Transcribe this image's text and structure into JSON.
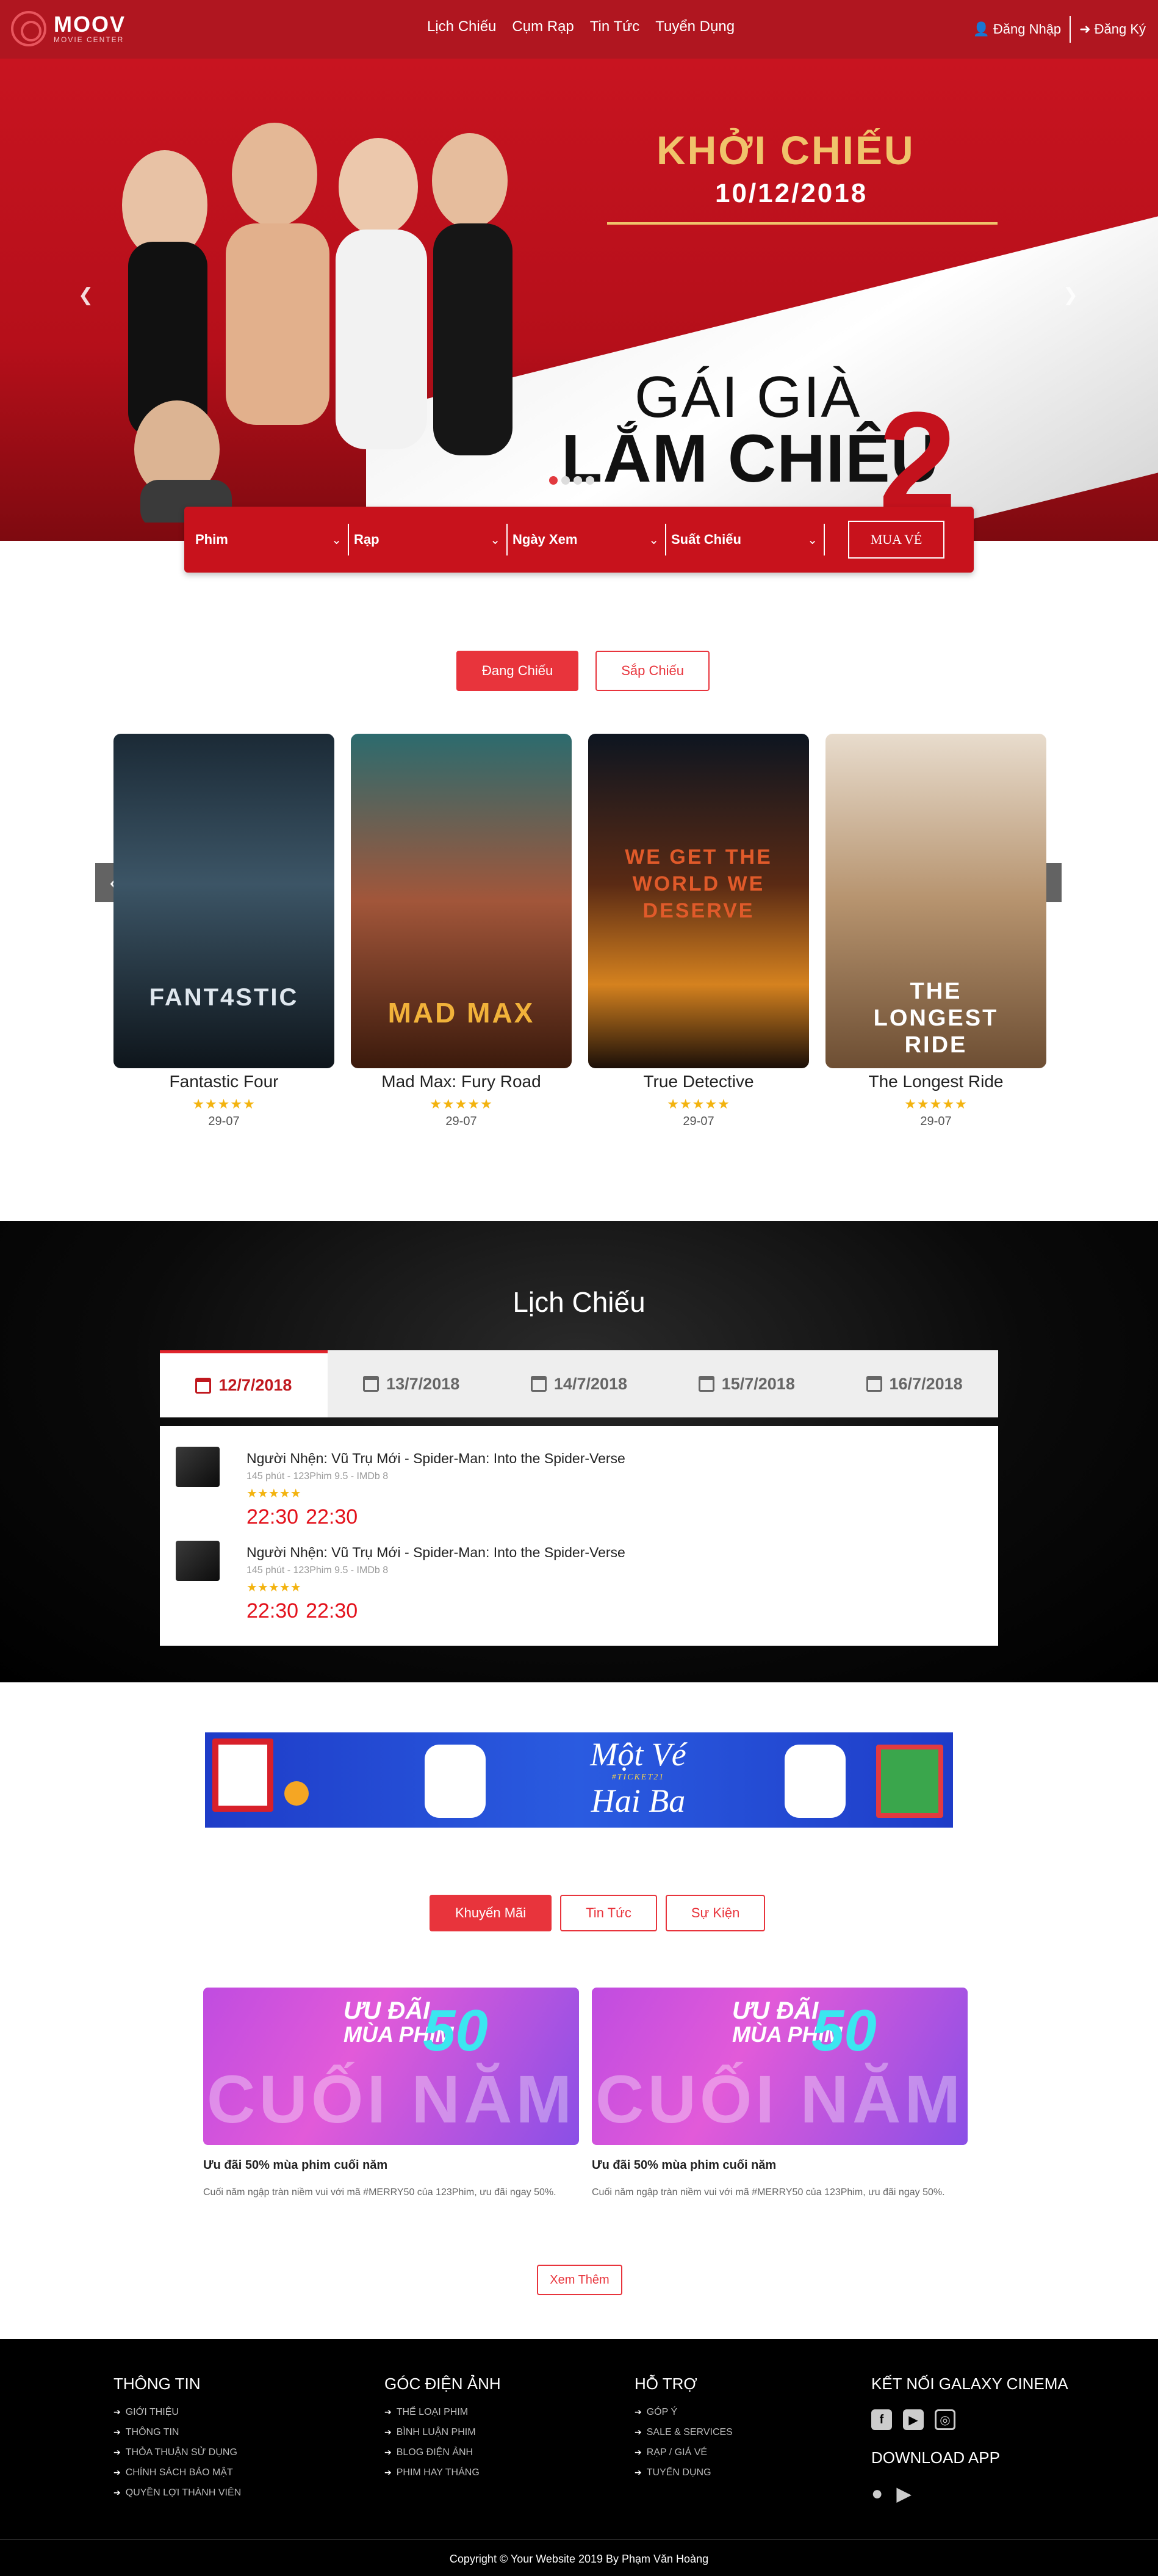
{
  "header": {
    "logo_title": "MOOV",
    "logo_sub": "MOVIE CENTER",
    "nav": [
      "Lịch Chiếu",
      "Cụm Rạp",
      "Tin Tức",
      "Tuyển Dụng"
    ],
    "login": "Đăng Nhập",
    "register": "Đăng Ký"
  },
  "hero": {
    "kicker": "KHỞI CHIẾU",
    "date": "10/12/2018",
    "title_line1": "GÁI GIÀ",
    "title_line2": "LẮM CHIÊU",
    "title_number": "2",
    "slide_count": 4,
    "active_slide": 1
  },
  "booking": {
    "fields": [
      "Phim",
      "Rạp",
      "Ngày Xem",
      "Suất Chiếu"
    ],
    "buy_label": "MUA VÉ"
  },
  "movie_tabs": {
    "now_showing": "Đang Chiếu",
    "coming_soon": "Sắp Chiếu"
  },
  "movies": [
    {
      "title": "Fantastic Four",
      "date": "29-07",
      "rating": 5,
      "poster_text": "FANT4STIC"
    },
    {
      "title": "Mad Max: Fury Road",
      "date": "29-07",
      "rating": 5,
      "poster_text": "MAD MAX"
    },
    {
      "title": "True Detective",
      "date": "29-07",
      "rating": 5,
      "poster_text": "WE GET THE WORLD WE DESERVE"
    },
    {
      "title": "The Longest Ride",
      "date": "29-07",
      "rating": 5,
      "poster_text": "THE LONGEST RIDE"
    }
  ],
  "schedule": {
    "title": "Lịch Chiếu",
    "days": [
      "12/7/2018",
      "13/7/2018",
      "14/7/2018",
      "15/7/2018",
      "16/7/2018"
    ],
    "active_day": 0,
    "shows": [
      {
        "name": "Người Nhện: Vũ Trụ Mới - Spider-Man: Into the Spider-Verse",
        "meta": "145 phút - 123Phim 9.5 - IMDb 8",
        "rating": 5,
        "times": [
          "22:30",
          "22:30"
        ]
      },
      {
        "name": "Người Nhện: Vũ Trụ Mới - Spider-Man: Into the Spider-Verse",
        "meta": "145 phút - 123Phim 9.5 - IMDb 8",
        "rating": 5,
        "times": [
          "22:30",
          "22:30"
        ]
      }
    ]
  },
  "banner": {
    "line1": "Một Vé",
    "tag": "#TICKET21",
    "line2": "Hai Ba"
  },
  "news_tabs": [
    "Khuyến Mãi",
    "Tin Tức",
    "Sự Kiện"
  ],
  "news": [
    {
      "title": "Ưu đãi 50% mùa phim cuối năm",
      "desc": "Cuối năm ngập tràn niềm vui với mã #MERRY50 của 123Phim, ưu đãi ngay 50%.",
      "img_line1": "ƯU ĐÃI",
      "img_line2": "MÙA PHIM",
      "img_percent": "50",
      "img_big": "CUỐI NĂM"
    },
    {
      "title": "Ưu đãi 50% mùa phim cuối năm",
      "desc": "Cuối năm ngập tràn niềm vui với mã #MERRY50 của 123Phim, ưu đãi ngay 50%.",
      "img_line1": "ƯU ĐÃI",
      "img_line2": "MÙA PHIM",
      "img_percent": "50",
      "img_big": "CUỐI NĂM"
    }
  ],
  "more_label": "Xem Thêm",
  "footer": {
    "columns": [
      {
        "title": "THÔNG TIN",
        "items": [
          "GIỚI THIỆU",
          "THÔNG TIN",
          "THỎA THUẬN SỬ DỤNG",
          "CHÍNH SÁCH BẢO MẬT",
          "QUYỀN LỢI THÀNH VIÊN"
        ]
      },
      {
        "title": "GÓC ĐIỆN ẢNH",
        "items": [
          "THỂ LOẠI PHIM",
          "BÌNH LUẬN PHIM",
          "BLOG ĐIỆN ẢNH",
          "PHIM HAY THÁNG"
        ]
      },
      {
        "title": "HỖ TRỢ",
        "items": [
          "GÓP Ý",
          "SALE & SERVICES",
          "RẠP / GIÁ VÉ",
          "TUYỂN DỤNG"
        ]
      }
    ],
    "connect_title": "KẾT NỐI GALAXY CINEMA",
    "social_icons": [
      "facebook-icon",
      "youtube-icon",
      "instagram-icon"
    ],
    "download_title": "DOWNLOAD APP",
    "app_icons": [
      "apple-icon",
      "google-play-icon"
    ],
    "copyright": "Copyright © Your Website 2019 By Phạm Văn Hoàng"
  },
  "colors": {
    "brand_red": "#c8121c",
    "accent_red": "#e8343c",
    "star": "#f3b30f"
  }
}
